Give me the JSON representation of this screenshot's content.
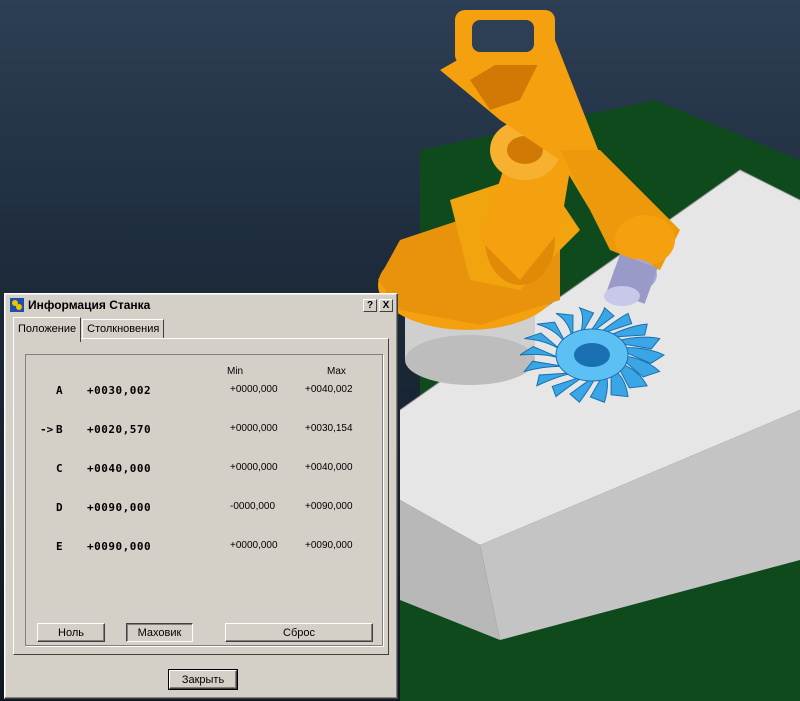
{
  "dialog": {
    "title": "Информация Станка",
    "help_btn": "?",
    "close_btn": "X",
    "tabs": [
      {
        "label": "Положение",
        "active": true
      },
      {
        "label": "Столкновения",
        "active": false
      }
    ],
    "headers": {
      "min": "Min",
      "max": "Max"
    },
    "axes": [
      {
        "name": "A",
        "arrow": "",
        "value": "+0030,002",
        "min": "+0000,000",
        "max": "+0040,002"
      },
      {
        "name": "B",
        "arrow": "->",
        "value": "+0020,570",
        "min": "+0000,000",
        "max": "+0030,154"
      },
      {
        "name": "C",
        "arrow": "",
        "value": "+0040,000",
        "min": "+0000,000",
        "max": "+0040,000"
      },
      {
        "name": "D",
        "arrow": "",
        "value": "+0090,000",
        "min": "-0000,000",
        "max": "+0090,000"
      },
      {
        "name": "E",
        "arrow": "",
        "value": "+0090,000",
        "min": "+0000,000",
        "max": "+0090,000"
      }
    ],
    "buttons": {
      "zero": "Ноль",
      "handwheel": "Маховик",
      "reset": "Сброс",
      "close": "Закрыть"
    }
  },
  "colors": {
    "robot": "#f5a00e",
    "turbine": "#3aa6e6",
    "table": "#e4e4e4",
    "floor": "#0e4a1c",
    "bg": "#1c2a3a"
  }
}
